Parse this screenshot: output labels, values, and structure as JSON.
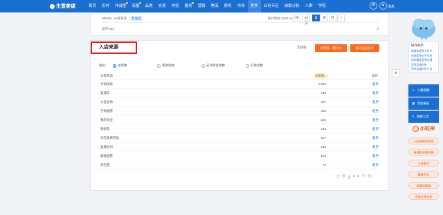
{
  "header": {
    "brand": "生意参谋",
    "nav": [
      {
        "label": "首页",
        "selected": false,
        "dot": false
      },
      {
        "label": "实时",
        "selected": false,
        "dot": false
      },
      {
        "label": "作战室",
        "selected": false,
        "dot": true
      },
      {
        "label": "流量",
        "selected": false,
        "dot": true
      },
      {
        "label": "品类",
        "selected": false,
        "dot": false
      },
      {
        "label": "交易",
        "selected": false,
        "dot": false
      },
      {
        "label": "内容",
        "selected": false,
        "dot": false
      },
      {
        "label": "服务",
        "selected": false,
        "dot": true
      },
      {
        "label": "营销",
        "selected": false,
        "dot": false
      },
      {
        "label": "物流",
        "selected": false,
        "dot": false
      },
      {
        "label": "财务",
        "selected": false,
        "dot": false
      },
      {
        "label": "市场",
        "selected": false,
        "dot": false
      },
      {
        "label": "竞争",
        "selected": true,
        "dot": false
      },
      {
        "label": "业务专区",
        "selected": false,
        "dot": false
      },
      {
        "label": "自助分析",
        "selected": false,
        "dot": false
      },
      {
        "label": "人群",
        "selected": false,
        "dot": false
      },
      {
        "label": "学院",
        "selected": false,
        "dot": false
      }
    ],
    "icons": [
      "bell-icon",
      "message-icon"
    ],
    "user": "消息"
  },
  "top_panel": {
    "item_name": "MP3/M...ds等等等",
    "item_tag": "标准视",
    "update_label": "统计时间 2020-11-02",
    "periods": [
      {
        "label": "7天",
        "active": false
      },
      {
        "label": "30天",
        "active": false
      },
      {
        "label": "日",
        "active": true
      },
      {
        "label": "周",
        "active": false
      },
      {
        "label": "月",
        "active": false
      },
      {
        "label": "‹ 〉",
        "active": false
      }
    ],
    "row_name": "蓝牙mp3",
    "row_value": "0"
  },
  "source_panel": {
    "title": "入店来源",
    "compare_label": "无线端",
    "btn_compare": "小旺旺一键对比",
    "btn_competitor": "多天竞品分析",
    "metric_label": "指标:",
    "metrics": [
      {
        "label": "访客数",
        "checked": true
      },
      {
        "label": "客群指数",
        "checked": false
      },
      {
        "label": "支付转化指数",
        "checked": false
      },
      {
        "label": "交易指数",
        "checked": false
      }
    ],
    "col_source": "流量来源",
    "col_visitors": "访客数",
    "col_visitors_arrow": "↓",
    "col_action": "操作",
    "rows": [
      {
        "source": "手淘搜索",
        "visitors": "1,818",
        "action": "趋势"
      },
      {
        "source": "直通车",
        "visitors": "349",
        "action": "趋势"
      },
      {
        "source": "大促会场",
        "visitors": "327",
        "action": "趋势"
      },
      {
        "source": "手淘推荐",
        "visitors": "306",
        "action": "趋势"
      },
      {
        "source": "我的淘宝",
        "visitors": "224",
        "action": "趋势"
      },
      {
        "source": "购物车",
        "visitors": "216",
        "action": "趋势"
      },
      {
        "source": "淘内免费其他",
        "visitors": "167",
        "action": "趋势"
      },
      {
        "source": "直播访问",
        "visitors": "158",
        "action": "趋势"
      },
      {
        "source": "超级推荐",
        "visitors": "104",
        "action": "趋势"
      },
      {
        "source": "淘宝客",
        "visitors": "74",
        "action": "趋势"
      }
    ],
    "pager": {
      "prev": "‹ 上一页",
      "pages": [
        "1",
        "2",
        "3"
      ],
      "current": "1",
      "next": "下一页 ›"
    }
  },
  "right_panel": {
    "title": "操作助手",
    "links": [
      "新版本竞争分析中...",
      "市场竞争对手分析",
      "如何确定竞争店铺",
      "竞争店铺分析",
      "竞争店铺分析方法"
    ],
    "buttons": [
      {
        "label": "人群洞察",
        "icon": "people-icon"
      },
      {
        "label": "活动报名",
        "icon": "calendar-icon"
      },
      {
        "label": "快捷工具",
        "icon": "tool-icon"
      }
    ],
    "assistant": "小旺神",
    "pills": [
      "小旺神帮你找货",
      "直通车流量诊断",
      "大促助手",
      "蓄客专区",
      "流量加速器",
      "活动订单分析"
    ]
  },
  "colors": {
    "primary": "#1b6fd1",
    "accent": "#ff6a1a",
    "highlight": "#e02020"
  }
}
